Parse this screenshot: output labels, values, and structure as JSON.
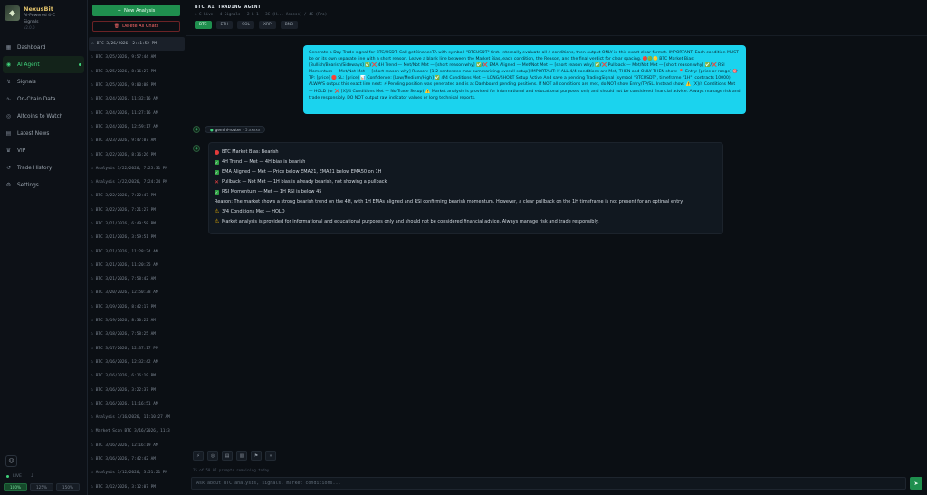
{
  "brand": {
    "name": "NexusBit",
    "subtitle_1": "AI-Powered 4-C",
    "subtitle_2": "Signals",
    "tagline": "v2.0.0"
  },
  "nav": [
    {
      "label": "Dashboard",
      "icon": "grid-icon"
    },
    {
      "label": "AI Agent",
      "icon": "bot-icon",
      "active": true
    },
    {
      "label": "Signals",
      "icon": "signal-icon"
    },
    {
      "label": "On-Chain Data",
      "icon": "chain-icon"
    },
    {
      "label": "Altcoins to Watch",
      "icon": "eye-icon"
    },
    {
      "label": "Latest News",
      "icon": "news-icon"
    },
    {
      "label": "VIP",
      "icon": "crown-icon"
    },
    {
      "label": "Trade History",
      "icon": "history-icon"
    },
    {
      "label": "Settings",
      "icon": "gear-icon"
    }
  ],
  "sidebar_bottom": {
    "status": "LIVE",
    "zoom": [
      "100%",
      "125%",
      "150%"
    ]
  },
  "chatlist": {
    "new_label": "New Analysis",
    "delete_label": "Delete All Chats",
    "items": [
      "BTC 3/26/2026, 2:41:52 PM",
      "BTC 3/25/2026, 9:57:44 AM",
      "BTC 3/25/2026, 8:16:27 PM",
      "BTC 3/25/2026, 9:00:08 PM",
      "BTC 3/24/2026, 11:32:16 AM",
      "BTC 3/24/2026, 11:27:16 AM",
      "BTC 3/24/2026, 12:59:17 AM",
      "BTC 3/23/2026, 9:47:07 AM",
      "BTC 3/22/2026, 8:36:26 PM",
      "Analysis 3/22/2026, 7:25:31 PM",
      "Analysis 3/22/2026, 7:24:24 PM",
      "BTC 3/22/2026, 7:22:47 PM",
      "BTC 3/22/2026, 7:21:27 PM",
      "BTC 3/21/2026, 6:49:58 PM",
      "BTC 3/21/2026, 3:59:51 PM",
      "BTC 3/21/2026, 11:28:24 AM",
      "BTC 3/21/2026, 11:20:35 AM",
      "BTC 3/21/2026, 7:58:42 AM",
      "BTC 3/20/2026, 12:50:38 AM",
      "BTC 3/19/2026, 8:42:17 PM",
      "BTC 3/19/2026, 8:30:22 AM",
      "BTC 3/18/2026, 7:58:25 AM",
      "BTC 3/17/2026, 12:37:17 PM",
      "BTC 3/16/2026, 12:32:42 AM",
      "BTC 3/16/2026, 6:16:19 PM",
      "BTC 3/16/2026, 3:22:37 PM",
      "BTC 3/16/2026, 11:16:51 AM",
      "Analysis 3/16/2026, 11:10:27 AM",
      "Market Scan BTC 3/16/2026, 11:3",
      "BTC 3/16/2026, 12:16:19 AM",
      "BTC 3/16/2026, 7:42:42 AM",
      "Analysis 3/12/2026, 3:51:21 PM",
      "BTC 3/12/2026, 3:12:07 PM"
    ]
  },
  "header": {
    "title": "BTC AI TRADING AGENT",
    "subtitle": "4 C Live · 4 Signals · 2 L-1 · 3C (H... Assess) / 4C (Pro)",
    "chips": [
      "BTC",
      "ETH",
      "SOL",
      "XRP",
      "BNB"
    ]
  },
  "user_message": "Generate a Day Trade signal for BTC/USDT. Call getBinanceTA with symbol: \"BTCUSDT\" first. Internally evaluate all 4 conditions, then output ONLY in this exact clear format. IMPORTANT: Each condition MUST be on its own separate line with a short reason. Leave a blank line between the Market Bias, each condition, the Reason, and the final verdict for clear spacing. 🔴🟢🟡 BTC Market Bias: [Bullish/Bearish/Sideways] ✅/❌ 4H Trend — Met/Not Met — [short reason why] ✅/❌ EMA Aligned — Met/Not Met — [short reason why] ✅/❌ Pullback — Met/Not Met — [short reason why] ✅/❌ RSI Momentum — Met/Not Met — [short reason why] Reason: [1-2 sentences max summarizing overall setup] IMPORTANT: If ALL 4/4 conditions are Met, THEN and ONLY THEN show: 📍 Entry: [price or range] 🎯 TP: [price] 🛑 SL: [price] 📊 Confidence: [Low/Medium/High] ✅ 4/4 Conditions Met — LONG/SHORT Setup Active And save a pending TradingSignal (symbol \"BTCUSDT\", timeframe \"1H\", contracts 10000). ALWAYS output this exact line next: ⚡ Pending position was generated and is at Dashboard pending positions. If NOT all conditions are met, do NOT show Entry/TP/SL. Instead show: ⚠️ [X]/4 Conditions Met — HOLD (or ❌ [X]/4 Conditions Met — No Trade Setup) ⚠️ Market analysis is provided for informational and educational purposes only and should not be considered financial advice. Always manage risk and trade responsibly. DO NOT output raw indicator values or long technical reports.",
  "model": {
    "name": "gemini-router",
    "suffix": "· 5.xxxxx"
  },
  "response": {
    "bias": "BTC Market Bias: Bearish",
    "trend": "4H Trend — Met — 4H bias is bearish",
    "ema": "EMA Aligned — Met — Price below EMA21, EMA21 below EMA50 on 1H",
    "pullback": "Pullback — Not Met — 1H bias is already bearish, not showing a pullback",
    "rsi": "RSI Momentum — Met — 1H RSI is below 45",
    "reason": "Reason: The market shows a strong bearish trend on the 4H, with 1H EMAs aligned and RSI confirming bearish momentum. However, a clear pullback on the 1H timeframe is not present for an optimal entry.",
    "verdict": "3/4 Conditions Met — HOLD",
    "disclaimer": "Market analysis is provided for informational and educational purposes only and should not be considered financial advice. Always manage risk and trade responsibly."
  },
  "composer": {
    "hint": "25 of 50 AI prompts remaining today",
    "placeholder": "Ask about BTC analysis, signals, market conditions..."
  }
}
